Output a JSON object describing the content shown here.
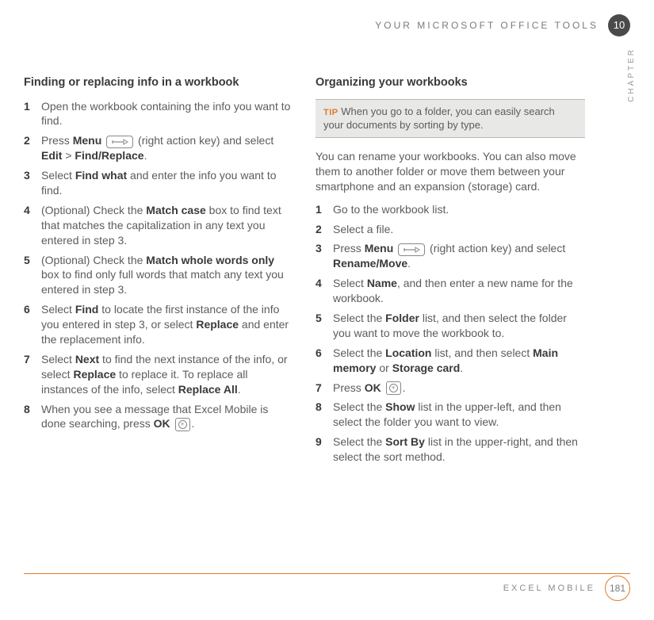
{
  "header": {
    "top_title": "YOUR MICROSOFT OFFICE TOOLS",
    "chapter_number": "10",
    "chapter_label": "CHAPTER"
  },
  "left": {
    "heading": "Finding or replacing info in a workbook",
    "steps": [
      {
        "n": "1",
        "pre": "Open the workbook containing the info you want to find."
      },
      {
        "n": "2",
        "pre": "Press ",
        "b1": "Menu",
        "mid": " ",
        "icon": "menu",
        "post": " (right action key) and select ",
        "b2": "Edit",
        "sep": " > ",
        "b3": "Find/Replace",
        "end": "."
      },
      {
        "n": "3",
        "pre": "Select ",
        "b1": "Find what",
        "post": " and enter the info you want to find."
      },
      {
        "n": "4",
        "pre": "(Optional)  Check the ",
        "b1": "Match case",
        "post": " box to find text that matches the capitalization in any text you entered in step 3."
      },
      {
        "n": "5",
        "pre": "(Optional)  Check the ",
        "b1": "Match whole words only",
        "post": " box to find only full words that match any text you entered in step 3."
      },
      {
        "n": "6",
        "pre": "Select ",
        "b1": "Find",
        "mid": " to locate the first instance of the info you entered in step 3, or select ",
        "b2": "Replace",
        "post": " and enter the replacement info."
      },
      {
        "n": "7",
        "pre": "Select ",
        "b1": "Next",
        "mid": " to find the next instance of the info, or select ",
        "b2": "Replace",
        "mid2": " to replace it. To replace all instances of the info, select ",
        "b3": "Replace All",
        "end": "."
      },
      {
        "n": "8",
        "pre": "When you see a message that Excel Mobile is done searching, press ",
        "b1": "OK",
        "icon": "ok",
        "end": "."
      }
    ]
  },
  "right": {
    "heading": "Organizing your workbooks",
    "tip_label": "TIP",
    "tip_text": " When you go to a folder, you can easily search your documents by sorting by type.",
    "intro": "You can rename your workbooks. You can also move them to another folder or move them between your smartphone and an expansion (storage) card.",
    "steps": [
      {
        "n": "1",
        "pre": "Go to the workbook list."
      },
      {
        "n": "2",
        "pre": "Select a file."
      },
      {
        "n": "3",
        "pre": "Press ",
        "b1": "Menu",
        "icon": "menu",
        "mid": " (right action key) and select ",
        "b2": "Rename/Move",
        "end": "."
      },
      {
        "n": "4",
        "pre": "Select ",
        "b1": "Name",
        "post": ", and then enter a new name for the workbook."
      },
      {
        "n": "5",
        "pre": "Select the ",
        "b1": "Folder",
        "post": " list, and then select the folder you want to move the workbook to."
      },
      {
        "n": "6",
        "pre": "Select the ",
        "b1": "Location",
        "mid": " list, and then select ",
        "b2": "Main memory",
        "sep": " or ",
        "b3": "Storage card",
        "end": "."
      },
      {
        "n": "7",
        "pre": "Press ",
        "b1": "OK",
        "icon": "ok",
        "end": "."
      },
      {
        "n": "8",
        "pre": "Select the ",
        "b1": "Show",
        "post": " list in the upper-left, and then select the folder you want to view."
      },
      {
        "n": "9",
        "pre": "Select the ",
        "b1": "Sort By",
        "post": " list in the upper-right, and then select the sort method."
      }
    ]
  },
  "footer": {
    "title": "EXCEL MOBILE",
    "page_number": "181"
  }
}
